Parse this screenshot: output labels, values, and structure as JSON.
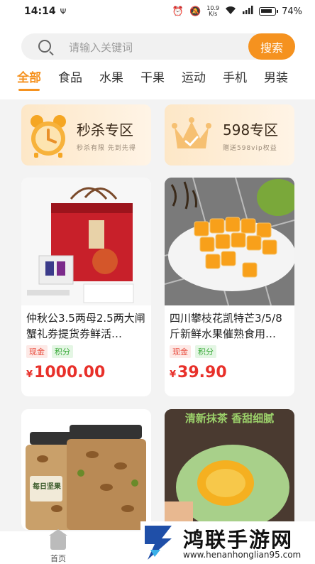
{
  "status_bar": {
    "time": "14:14",
    "usb_symbol": "Ψ",
    "net_speed_top": "10.9",
    "net_speed_bottom": "K/s",
    "battery_percent": "74%"
  },
  "search": {
    "placeholder": "请输入关键词",
    "button_label": "搜索"
  },
  "tabs": [
    {
      "label": "全部",
      "active": true
    },
    {
      "label": "食品"
    },
    {
      "label": "水果"
    },
    {
      "label": "干果"
    },
    {
      "label": "运动"
    },
    {
      "label": "手机"
    },
    {
      "label": "男装"
    }
  ],
  "promos": [
    {
      "title": "秒杀专区",
      "subtitle": "秒杀有限 先到先得",
      "icon": "alarm-clock-icon"
    },
    {
      "title": "598专区",
      "subtitle": "赠送598vip权益",
      "icon": "crown-icon"
    }
  ],
  "products": [
    {
      "title": "仲秋公3.5两母2.5两大闸蟹礼券提货券鲜活…",
      "tags": [
        "现金",
        "积分"
      ],
      "currency": "¥",
      "price": "1000.00",
      "image": "crab-gift-box-image"
    },
    {
      "title": "四川攀枝花凯特芒3/5/8斤新鲜水果催熟食用…",
      "tags": [
        "现金",
        "积分"
      ],
      "currency": "¥",
      "price": "39.90",
      "image": "mango-image"
    },
    {
      "title": "",
      "image": "mixed-nuts-jar-image",
      "image_text": "每日坚果"
    },
    {
      "title": "",
      "image": "matcha-pastry-image",
      "image_text": "清新抹茶 香甜细腻"
    }
  ],
  "bottom_nav": {
    "home_label": "首页"
  },
  "watermark": {
    "title": "鸿联手游网",
    "url": "www.henanhonglian95.com"
  },
  "colors": {
    "accent": "#f5921f",
    "price_red": "#e8302a",
    "cash_tag": "#e84a3c",
    "points_tag": "#3aaa3a"
  }
}
